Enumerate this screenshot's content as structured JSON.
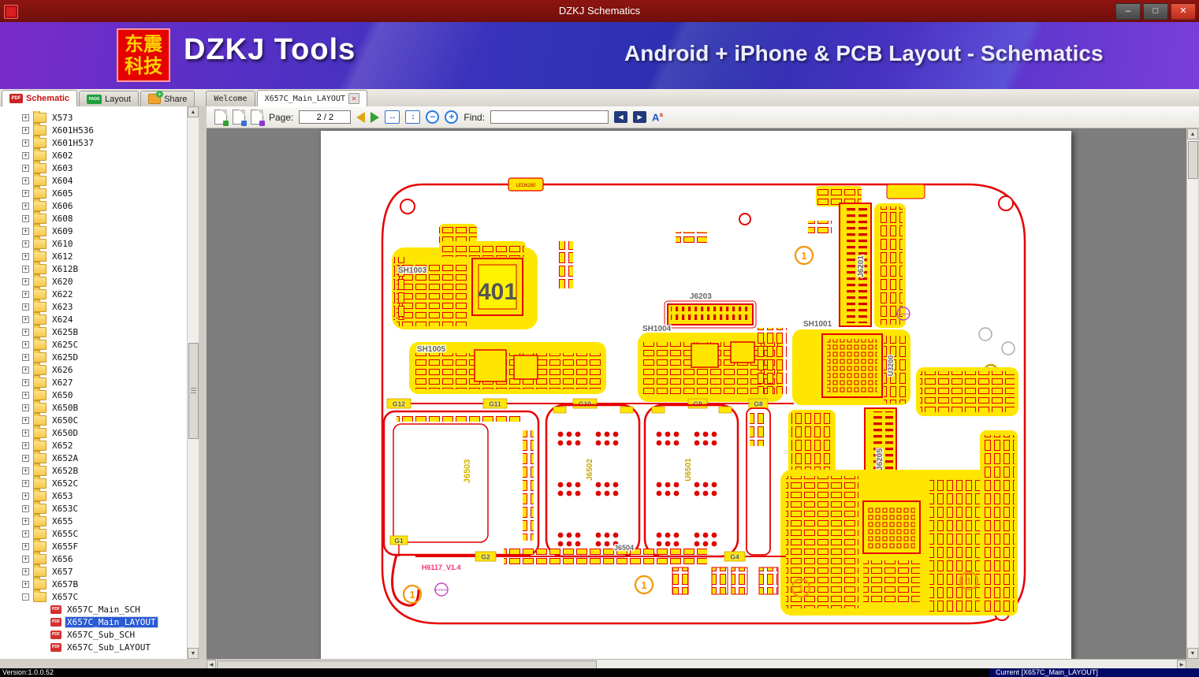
{
  "window": {
    "title": "DZKJ Schematics"
  },
  "banner": {
    "logo_line1": "东震",
    "logo_line2": "科技",
    "brand": "DZKJ Tools",
    "tagline": "Android + iPhone & PCB Layout - Schematics"
  },
  "icons": {
    "pdf": "PDF",
    "pads": "PADS"
  },
  "tabs": {
    "main": [
      {
        "label": "Schematic"
      },
      {
        "label": "Layout"
      },
      {
        "label": "Share"
      }
    ],
    "docs": [
      {
        "label": "Welcome"
      },
      {
        "label": "X657C_Main_LAYOUT"
      }
    ]
  },
  "toolbar": {
    "page_label": "Page:",
    "page_value": "2 / 2",
    "find_label": "Find:",
    "find_value": ""
  },
  "sidebar": {
    "expand_plus": "+",
    "expand_minus": "-",
    "pdf_icon_text": "PDF",
    "items": [
      {
        "label": "X573",
        "type": "folder",
        "expand": "plus"
      },
      {
        "label": "X601H536",
        "type": "folder",
        "expand": "plus"
      },
      {
        "label": "X601H537",
        "type": "folder",
        "expand": "plus"
      },
      {
        "label": "X602",
        "type": "folder",
        "expand": "plus"
      },
      {
        "label": "X603",
        "type": "folder",
        "expand": "plus"
      },
      {
        "label": "X604",
        "type": "folder",
        "expand": "plus"
      },
      {
        "label": "X605",
        "type": "folder",
        "expand": "plus"
      },
      {
        "label": "X606",
        "type": "folder",
        "expand": "plus"
      },
      {
        "label": "X608",
        "type": "folder",
        "expand": "plus"
      },
      {
        "label": "X609",
        "type": "folder",
        "expand": "plus"
      },
      {
        "label": "X610",
        "type": "folder",
        "expand": "plus"
      },
      {
        "label": "X612",
        "type": "folder",
        "expand": "plus"
      },
      {
        "label": "X612B",
        "type": "folder",
        "expand": "plus"
      },
      {
        "label": "X620",
        "type": "folder",
        "expand": "plus"
      },
      {
        "label": "X622",
        "type": "folder",
        "expand": "plus"
      },
      {
        "label": "X623",
        "type": "folder",
        "expand": "plus"
      },
      {
        "label": "X624",
        "type": "folder",
        "expand": "plus"
      },
      {
        "label": "X625B",
        "type": "folder",
        "expand": "plus"
      },
      {
        "label": "X625C",
        "type": "folder",
        "expand": "plus"
      },
      {
        "label": "X625D",
        "type": "folder",
        "expand": "plus"
      },
      {
        "label": "X626",
        "type": "folder",
        "expand": "plus"
      },
      {
        "label": "X627",
        "type": "folder",
        "expand": "plus"
      },
      {
        "label": "X650",
        "type": "folder",
        "expand": "plus"
      },
      {
        "label": "X650B",
        "type": "folder",
        "expand": "plus"
      },
      {
        "label": "X650C",
        "type": "folder",
        "expand": "plus"
      },
      {
        "label": "X650D",
        "type": "folder",
        "expand": "plus"
      },
      {
        "label": "X652",
        "type": "folder",
        "expand": "plus"
      },
      {
        "label": "X652A",
        "type": "folder",
        "expand": "plus"
      },
      {
        "label": "X652B",
        "type": "folder",
        "expand": "plus"
      },
      {
        "label": "X652C",
        "type": "folder",
        "expand": "plus"
      },
      {
        "label": "X653",
        "type": "folder",
        "expand": "plus"
      },
      {
        "label": "X653C",
        "type": "folder",
        "expand": "plus"
      },
      {
        "label": "X655",
        "type": "folder",
        "expand": "plus"
      },
      {
        "label": "X655C",
        "type": "folder",
        "expand": "plus"
      },
      {
        "label": "X655F",
        "type": "folder",
        "expand": "plus"
      },
      {
        "label": "X656",
        "type": "folder",
        "expand": "plus"
      },
      {
        "label": "X657",
        "type": "folder",
        "expand": "plus"
      },
      {
        "label": "X657B",
        "type": "folder",
        "expand": "plus"
      },
      {
        "label": "X657C",
        "type": "folder",
        "expand": "minus"
      },
      {
        "label": "X657C_Main_SCH",
        "type": "pdf"
      },
      {
        "label": "X657C_Main_LAYOUT",
        "type": "pdf",
        "selected": true
      },
      {
        "label": "X657C_Sub_SCH",
        "type": "pdf"
      },
      {
        "label": "X657C_Sub_LAYOUT",
        "type": "pdf"
      }
    ]
  },
  "pcb": {
    "labels": {
      "chip": "401",
      "sh1003": "SH1003",
      "sh1005": "SH1005",
      "sh1004": "SH1004",
      "sh1001": "SH1001",
      "j6203": "J6203",
      "j6201": "J6201",
      "j6205": "J6205",
      "u3200": "U3200",
      "j6503": "J6503",
      "j6502": "J6502",
      "u6501": "U6501",
      "j6504": "J6504",
      "g12": "G12",
      "g11": "G11",
      "g10": "G10",
      "g9": "G9",
      "g8": "G8",
      "g1": "G1",
      "g2": "G2",
      "g4": "G4",
      "led": "LED6280",
      "rev": "H6117_V1.4",
      "mar1": "MAR6001",
      "mar2": "MAR6002",
      "marker": "1"
    }
  },
  "statusbar": {
    "version": "Version:1.0.0.52",
    "current": "Current [X657C_Main_LAYOUT]"
  }
}
